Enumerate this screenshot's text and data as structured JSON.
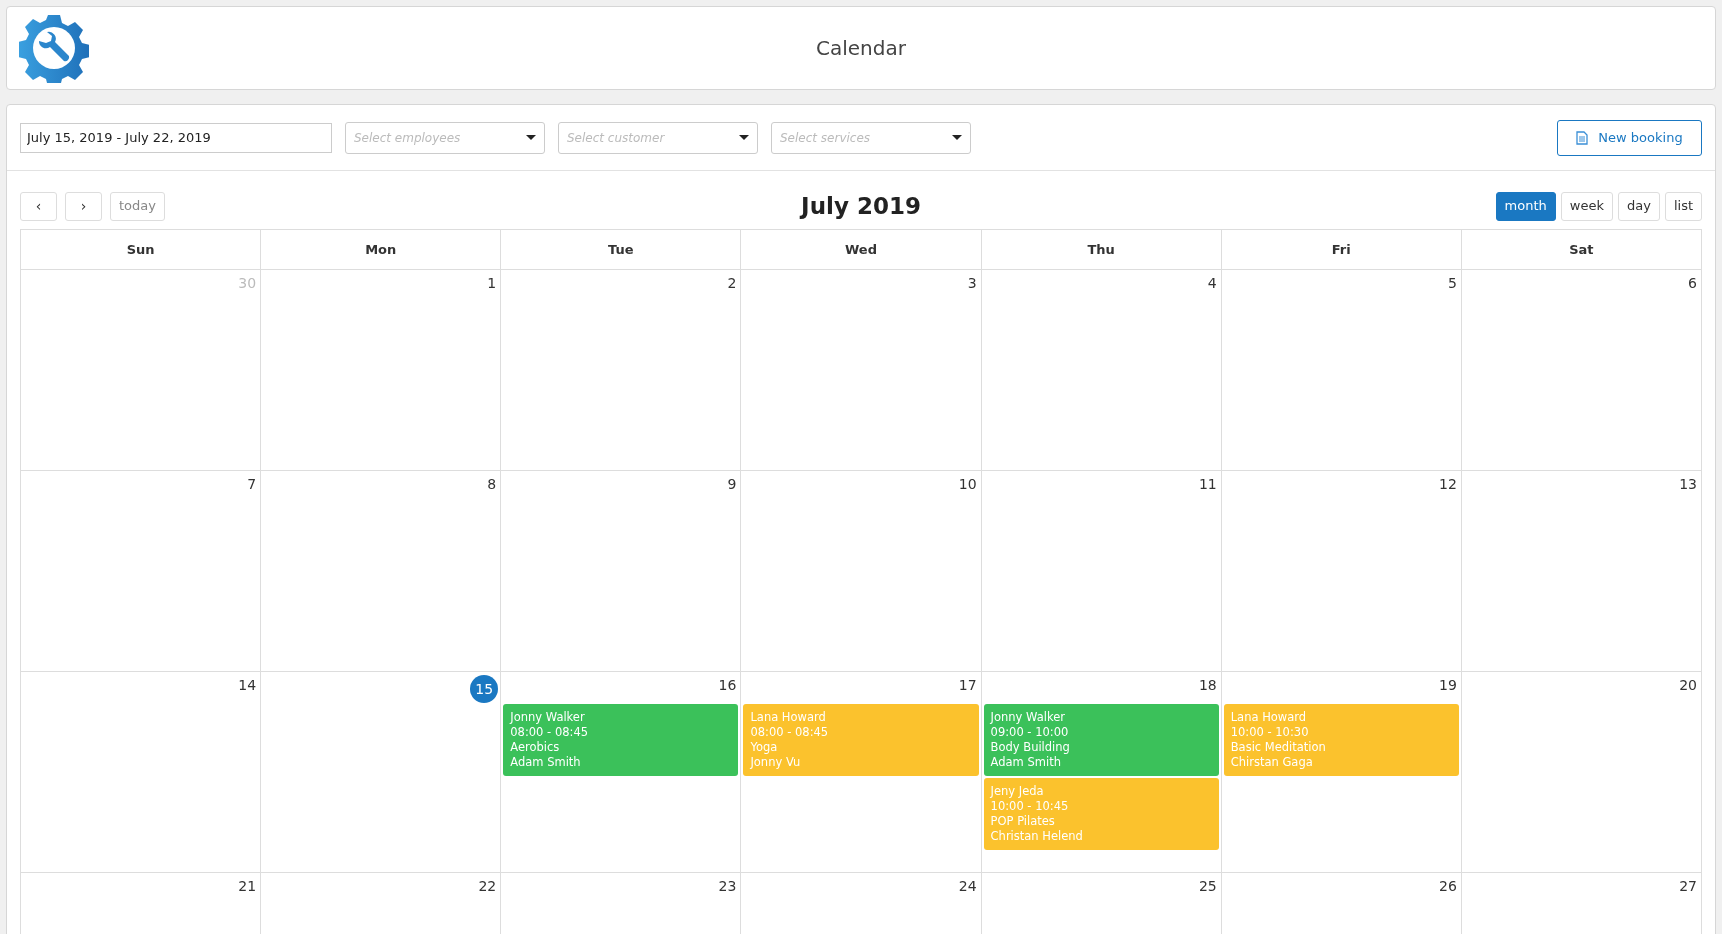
{
  "header": {
    "title": "Calendar"
  },
  "filters": {
    "date_range": "July 15, 2019 - July 22, 2019",
    "selects": [
      {
        "placeholder": "Select employees"
      },
      {
        "placeholder": "Select customer"
      },
      {
        "placeholder": "Select services"
      }
    ],
    "new_button": "New booking"
  },
  "nav": {
    "prev": "‹",
    "next": "›",
    "today": "today",
    "title": "July 2019",
    "views": [
      {
        "label": "month",
        "selected": true
      },
      {
        "label": "week",
        "selected": false
      },
      {
        "label": "day",
        "selected": false
      },
      {
        "label": "list",
        "selected": false
      }
    ]
  },
  "weekdays": [
    "Sun",
    "Mon",
    "Tue",
    "Wed",
    "Thu",
    "Fri",
    "Sat"
  ],
  "weeks": [
    [
      {
        "day": "30",
        "outside": true,
        "today": false
      },
      {
        "day": "1",
        "outside": false,
        "today": false
      },
      {
        "day": "2",
        "outside": false,
        "today": false
      },
      {
        "day": "3",
        "outside": false,
        "today": false
      },
      {
        "day": "4",
        "outside": false,
        "today": false
      },
      {
        "day": "5",
        "outside": false,
        "today": false
      },
      {
        "day": "6",
        "outside": false,
        "today": false
      }
    ],
    [
      {
        "day": "7",
        "outside": false,
        "today": false
      },
      {
        "day": "8",
        "outside": false,
        "today": false
      },
      {
        "day": "9",
        "outside": false,
        "today": false
      },
      {
        "day": "10",
        "outside": false,
        "today": false
      },
      {
        "day": "11",
        "outside": false,
        "today": false
      },
      {
        "day": "12",
        "outside": false,
        "today": false
      },
      {
        "day": "13",
        "outside": false,
        "today": false
      }
    ],
    [
      {
        "day": "14",
        "outside": false,
        "today": false
      },
      {
        "day": "15",
        "outside": false,
        "today": true
      },
      {
        "day": "16",
        "outside": false,
        "today": false,
        "events": [
          {
            "employee": "Jonny Walker",
            "time": "08:00 - 08:45",
            "service": "Aerobics",
            "customer": "Adam Smith",
            "color": "#3bc15a"
          }
        ]
      },
      {
        "day": "17",
        "outside": false,
        "today": false,
        "events": [
          {
            "employee": "Lana Howard",
            "time": "08:00 - 08:45",
            "service": "Yoga",
            "customer": "Jonny Vu",
            "color": "#fbc22d"
          }
        ]
      },
      {
        "day": "18",
        "outside": false,
        "today": false,
        "events": [
          {
            "employee": "Jonny Walker",
            "time": "09:00 - 10:00",
            "service": "Body Building",
            "customer": "Adam Smith",
            "color": "#3bc15a"
          },
          {
            "employee": "Jeny Jeda",
            "time": "10:00 - 10:45",
            "service": "POP Pilates",
            "customer": "Christan Helend",
            "color": "#fbc22d"
          }
        ]
      },
      {
        "day": "19",
        "outside": false,
        "today": false,
        "events": [
          {
            "employee": "Lana Howard",
            "time": "10:00 - 10:30",
            "service": "Basic Meditation",
            "customer": "Chirstan Gaga",
            "color": "#fbc22d"
          }
        ]
      },
      {
        "day": "20",
        "outside": false,
        "today": false
      }
    ],
    [
      {
        "day": "21",
        "outside": false,
        "today": false
      },
      {
        "day": "22",
        "outside": false,
        "today": false
      },
      {
        "day": "23",
        "outside": false,
        "today": false
      },
      {
        "day": "24",
        "outside": false,
        "today": false
      },
      {
        "day": "25",
        "outside": false,
        "today": false
      },
      {
        "day": "26",
        "outside": false,
        "today": false
      },
      {
        "day": "27",
        "outside": false,
        "today": false
      }
    ]
  ]
}
